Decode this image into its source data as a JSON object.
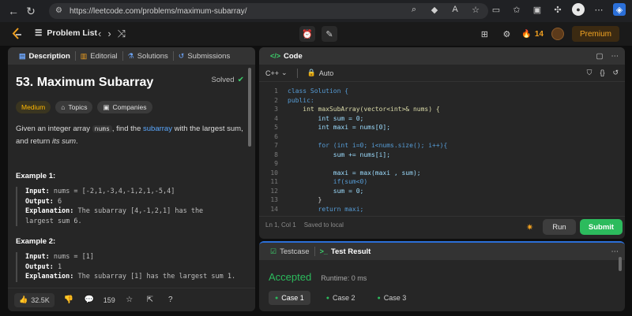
{
  "browser": {
    "url": "https://leetcode.com/problems/maximum-subarray/"
  },
  "topbar": {
    "problem_list_label": "Problem List",
    "streak_count": "14",
    "premium_label": "Premium"
  },
  "description_panel": {
    "tabs": [
      {
        "label": "Description"
      },
      {
        "label": "Editorial"
      },
      {
        "label": "Solutions"
      },
      {
        "label": "Submissions"
      }
    ],
    "title": "53. Maximum Subarray",
    "solved_label": "Solved",
    "chips": {
      "difficulty": "Medium",
      "topics": "Topics",
      "companies": "Companies"
    },
    "description": {
      "part1": "Given an integer array ",
      "code1": "nums",
      "part2": ", find the ",
      "link": "subarray",
      "part3": " with the largest sum, and return ",
      "em": "its sum",
      "part4": "."
    },
    "examples": [
      {
        "title": "Example 1:",
        "input_label": "Input:",
        "input_value": " nums = [-2,1,-3,4,-1,2,1,-5,4]",
        "output_label": "Output:",
        "output_value": " 6",
        "explanation_label": "Explanation:",
        "explanation_value": " The subarray [4,-1,2,1] has the largest sum 6."
      },
      {
        "title": "Example 2:",
        "input_label": "Input:",
        "input_value": " nums = [1]",
        "output_label": "Output:",
        "output_value": " 1",
        "explanation_label": "Explanation:",
        "explanation_value": " The subarray [1] has the largest sum 1."
      }
    ],
    "footer": {
      "likes": "32.5K",
      "comments": "159"
    }
  },
  "code_panel": {
    "tab_label": "Code",
    "language": "C++",
    "mode": "Auto",
    "line_numbers": [
      "1",
      "2",
      "3",
      "4",
      "5",
      "6",
      "7",
      "8",
      "9",
      "10",
      "11",
      "12",
      "13",
      "14"
    ],
    "lines": [
      "class Solution {",
      "public:",
      "    int maxSubArray(vector<int>& nums) {",
      "        int sum = 0;",
      "        int maxi = nums[0];",
      "",
      "        for (int i=0; i<nums.size(); i++){",
      "            sum += nums[i];",
      "",
      "            maxi = max(maxi , sum);",
      "            if(sum<0)",
      "            sum = 0;",
      "        }",
      "        return maxi;"
    ],
    "cursor": "Ln 1, Col 1",
    "saved": "Saved to local",
    "run_label": "Run",
    "submit_label": "Submit"
  },
  "result_panel": {
    "tabs": [
      {
        "label": "Testcase"
      },
      {
        "label": "Test Result"
      }
    ],
    "status": "Accepted",
    "runtime": "Runtime: 0 ms",
    "cases": [
      "Case 1",
      "Case 2",
      "Case 3"
    ]
  },
  "colors": {
    "accent_green": "#2cbb5d",
    "medium": "#ffb800",
    "link": "#5aa8ff"
  }
}
